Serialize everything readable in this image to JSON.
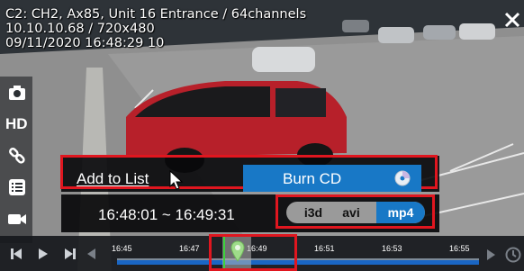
{
  "osd": {
    "line1": "C2: CH2, Ax85, Unit 16 Entrance / 64channels",
    "line2": "10.10.10.68 / 720x480",
    "line3": "09/11/2020 16:48:29 10"
  },
  "sidebar": {
    "hd_label": "HD",
    "icons": [
      "camera-icon",
      "hd-icon",
      "link-icon",
      "list-icon",
      "video-camera-icon"
    ]
  },
  "menu": {
    "add_to_list": "Add to List",
    "burn_cd": "Burn CD"
  },
  "export": {
    "time_range": "16:48:01 ~ 16:49:31",
    "formats": [
      "i3d",
      "avi",
      "mp4"
    ],
    "selected_format": "mp4"
  },
  "timeline": {
    "ticks": [
      "16:45",
      "16:47",
      "16:49",
      "16:51",
      "16:53",
      "16:55"
    ]
  },
  "colors": {
    "accent": "#1878c6",
    "highlight": "#e0161f",
    "marker": "#3cd23c"
  }
}
